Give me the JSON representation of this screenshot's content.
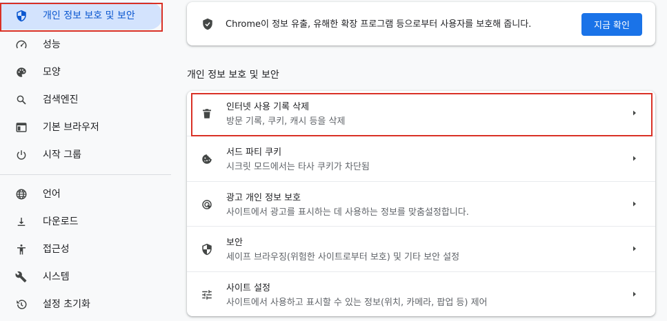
{
  "sidebar": {
    "items": [
      {
        "label": "개인 정보 보호 및 보안",
        "icon": "shield-icon"
      },
      {
        "label": "성능",
        "icon": "speedometer-icon"
      },
      {
        "label": "모양",
        "icon": "palette-icon"
      },
      {
        "label": "검색엔진",
        "icon": "search-icon"
      },
      {
        "label": "기본 브라우저",
        "icon": "browser-window-icon"
      },
      {
        "label": "시작 그룹",
        "icon": "power-icon"
      },
      {
        "label": "언어",
        "icon": "globe-icon"
      },
      {
        "label": "다운로드",
        "icon": "download-icon"
      },
      {
        "label": "접근성",
        "icon": "accessibility-icon"
      },
      {
        "label": "시스템",
        "icon": "wrench-icon"
      },
      {
        "label": "설정 초기화",
        "icon": "restore-icon"
      }
    ]
  },
  "banner": {
    "text": "Chrome이 정보 유출, 유해한 확장 프로그램 등으로부터 사용자를 보호해 줍니다.",
    "button_label": "지금 확인",
    "icon": "shield-check-icon"
  },
  "section": {
    "title": "개인 정보 보호 및 보안",
    "rows": [
      {
        "title": "인터넷 사용 기록 삭제",
        "subtitle": "방문 기록, 쿠키, 캐시 등을 삭제",
        "icon": "trash-icon"
      },
      {
        "title": "서드 파티 쿠키",
        "subtitle": "시크릿 모드에서는 타사 쿠키가 차단됨",
        "icon": "cookie-icon"
      },
      {
        "title": "광고 개인 정보 보호",
        "subtitle": "사이트에서 광고를 표시하는 데 사용하는 정보를 맞춤설정합니다.",
        "icon": "ad-privacy-icon"
      },
      {
        "title": "보안",
        "subtitle": "세이프 브라우징(위험한 사이트로부터 보호) 및 기타 보안 설정",
        "icon": "security-shield-icon"
      },
      {
        "title": "사이트 설정",
        "subtitle": "사이트에서 사용하고 표시할 수 있는 정보(위치, 카메라, 팝업 등) 제어",
        "icon": "tune-icon"
      }
    ]
  },
  "colors": {
    "accent": "#1a73e8",
    "active_nav_bg": "#d3e3fd",
    "highlight_border": "#d93025"
  }
}
